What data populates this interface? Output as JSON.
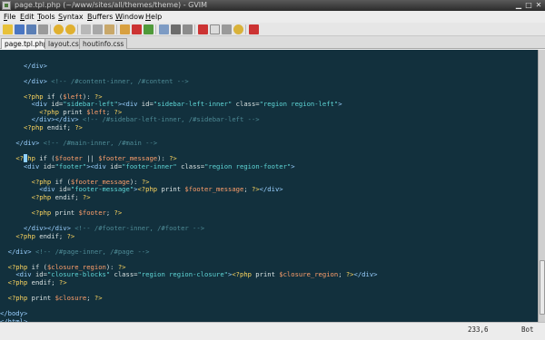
{
  "window": {
    "title": "page.tpl.php (~/www/sites/all/themes/theme) - GVIM",
    "buttons": {
      "minimize": "▁",
      "maximize": "□",
      "close": "✕"
    }
  },
  "menu": [
    {
      "label": "File",
      "ul": "F",
      "rest": "ile"
    },
    {
      "label": "Edit",
      "ul": "E",
      "rest": "dit"
    },
    {
      "label": "Tools",
      "ul": "T",
      "rest": "ools"
    },
    {
      "label": "Syntax",
      "ul": "S",
      "rest": "yntax"
    },
    {
      "label": "Buffers",
      "ul": "B",
      "rest": "uffers"
    },
    {
      "label": "Window",
      "ul": "W",
      "rest": "indow"
    },
    {
      "label": "Help",
      "ul": "H",
      "rest": "elp"
    }
  ],
  "toolbar": {
    "icons": [
      "open-icon",
      "save-icon",
      "save-all-icon",
      "print-icon",
      "undo-icon",
      "redo-icon",
      "cut-icon",
      "copy-icon",
      "paste-icon",
      "find-replace-icon",
      "find-next-icon",
      "find-prev-icon",
      "load-session-icon",
      "save-session-icon",
      "run-script-icon",
      "make-icon",
      "run-ctags-icon",
      "jump-tag-icon",
      "help-icon",
      "find-help-icon"
    ],
    "colors": {
      "yellow": "#e8c13a",
      "red": "#cc3333",
      "green": "#4f9a3a",
      "blue": "#4a76c2",
      "grey": "#9a9a9a"
    }
  },
  "tabs": [
    {
      "label": "page.tpl.php",
      "active": true
    },
    {
      "label": "layout.css",
      "active": false
    },
    {
      "label": "houtinfo.css",
      "active": false
    }
  ],
  "editor": {
    "lines": [
      "",
      "      </div>",
      "",
      "      </div> <!-- /#content-inner, /#content -->",
      "",
      "      <?php if ($left): ?>",
      "        <div id=\"sidebar-left\"><div id=\"sidebar-left-inner\" class=\"region region-left\">",
      "          <?php print $left; ?>",
      "        </div></div> <!-- /#sidebar-left-inner, /#sidebar-left -->",
      "      <?php endif; ?>",
      "",
      "    </div> <!-- /#main-inner, /#main -->",
      "",
      "    <?php if ($footer || $footer_message): ?>",
      "      <div id=\"footer\"><div id=\"footer-inner\" class=\"region region-footer\">",
      "",
      "        <?php if ($footer_message): ?>",
      "          <div id=\"footer-message\"><?php print $footer_message; ?></div>",
      "        <?php endif; ?>",
      "",
      "        <?php print $footer; ?>",
      "",
      "      </div></div> <!-- /#footer-inner, /#footer -->",
      "    <?php endif; ?>",
      "",
      "  </div> <!-- /#page-inner, /#page -->",
      "",
      "  <?php if ($closure_region): ?>",
      "    <div id=\"closure-blocks\" class=\"region region-closure\"><?php print $closure_region; ?></div>",
      "  <?php endif; ?>",
      "",
      "  <?php print $closure; ?>",
      "",
      "</body>",
      "</html>"
    ],
    "colors": {
      "background": "#12303d",
      "tag": "#9ad0ff",
      "php": "#ffd75f",
      "string": "#5fd7d7",
      "variable": "#ff9f6b",
      "comment": "#4e8a95"
    }
  },
  "status": {
    "position": "233,6",
    "location": "Bot"
  }
}
